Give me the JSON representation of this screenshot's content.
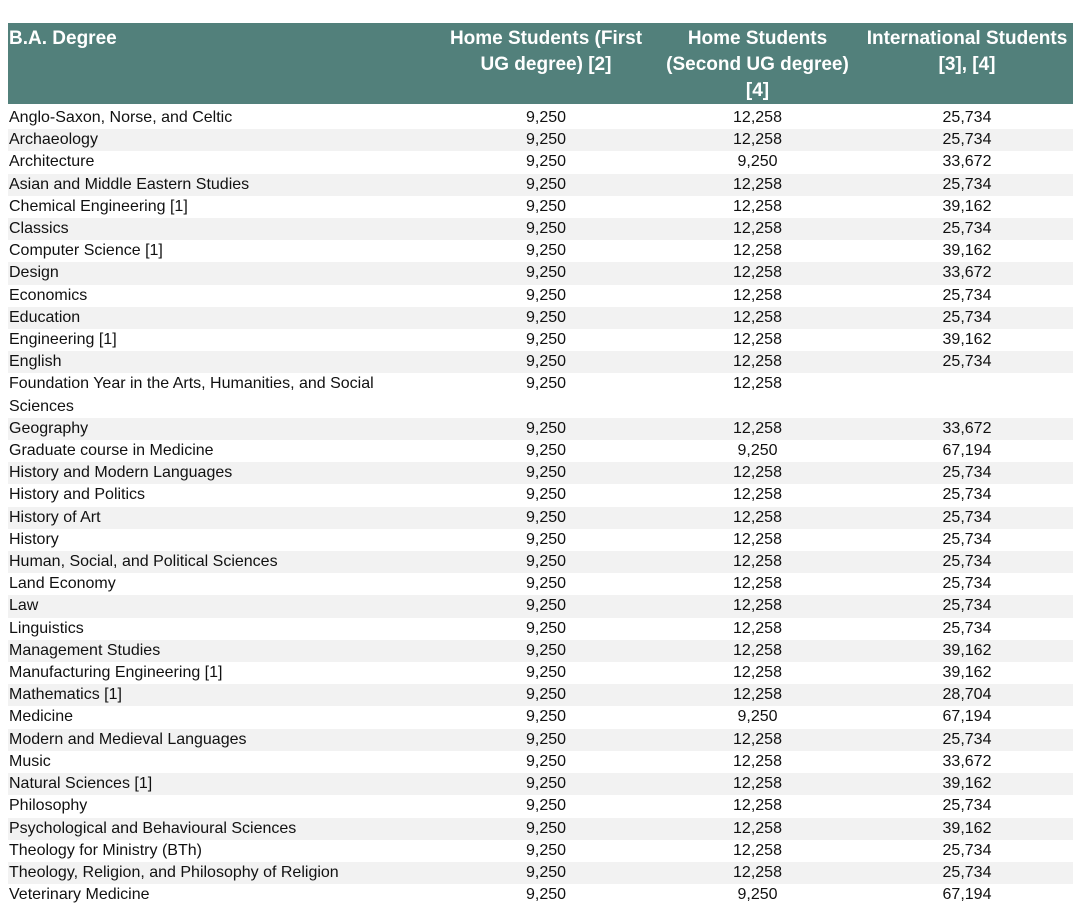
{
  "headers": {
    "degree": "B.A. Degree",
    "home_first": "Home Students (First UG degree) [2]",
    "home_second": "Home Students (Second UG degree) [4]",
    "international": "International Students [3], [4]"
  },
  "rows": [
    {
      "degree": "Anglo-Saxon, Norse, and Celtic",
      "home_first": "9,250",
      "home_second": "12,258",
      "international": "25,734"
    },
    {
      "degree": "Archaeology",
      "home_first": "9,250",
      "home_second": "12,258",
      "international": "25,734"
    },
    {
      "degree": "Architecture",
      "home_first": "9,250",
      "home_second": "9,250",
      "international": "33,672"
    },
    {
      "degree": "Asian and Middle Eastern Studies",
      "home_first": "9,250",
      "home_second": "12,258",
      "international": "25,734"
    },
    {
      "degree": "Chemical Engineering [1]",
      "home_first": "9,250",
      "home_second": "12,258",
      "international": "39,162"
    },
    {
      "degree": "Classics",
      "home_first": "9,250",
      "home_second": "12,258",
      "international": "25,734"
    },
    {
      "degree": "Computer Science [1]",
      "home_first": "9,250",
      "home_second": "12,258",
      "international": "39,162"
    },
    {
      "degree": "Design",
      "home_first": "9,250",
      "home_second": "12,258",
      "international": "33,672"
    },
    {
      "degree": "Economics",
      "home_first": "9,250",
      "home_second": "12,258",
      "international": "25,734"
    },
    {
      "degree": "Education",
      "home_first": "9,250",
      "home_second": "12,258",
      "international": "25,734"
    },
    {
      "degree": "Engineering [1]",
      "home_first": "9,250",
      "home_second": "12,258",
      "international": "39,162"
    },
    {
      "degree": "English",
      "home_first": "9,250",
      "home_second": "12,258",
      "international": "25,734"
    },
    {
      "degree": "Foundation Year in the Arts, Humanities, and Social Sciences",
      "home_first": "9,250",
      "home_second": "12,258",
      "international": ""
    },
    {
      "degree": "Geography",
      "home_first": "9,250",
      "home_second": "12,258",
      "international": "33,672"
    },
    {
      "degree": "Graduate course in Medicine",
      "home_first": "9,250",
      "home_second": "9,250",
      "international": "67,194"
    },
    {
      "degree": "History and Modern Languages",
      "home_first": "9,250",
      "home_second": "12,258",
      "international": "25,734"
    },
    {
      "degree": "History and Politics",
      "home_first": "9,250",
      "home_second": "12,258",
      "international": "25,734"
    },
    {
      "degree": "History of Art",
      "home_first": "9,250",
      "home_second": "12,258",
      "international": "25,734"
    },
    {
      "degree": "History",
      "home_first": "9,250",
      "home_second": "12,258",
      "international": "25,734"
    },
    {
      "degree": "Human, Social, and Political Sciences",
      "home_first": "9,250",
      "home_second": "12,258",
      "international": "25,734"
    },
    {
      "degree": "Land Economy",
      "home_first": "9,250",
      "home_second": "12,258",
      "international": "25,734"
    },
    {
      "degree": "Law",
      "home_first": "9,250",
      "home_second": "12,258",
      "international": "25,734"
    },
    {
      "degree": "Linguistics",
      "home_first": "9,250",
      "home_second": "12,258",
      "international": "25,734"
    },
    {
      "degree": "Management Studies",
      "home_first": "9,250",
      "home_second": "12,258",
      "international": "39,162"
    },
    {
      "degree": "Manufacturing Engineering [1]",
      "home_first": "9,250",
      "home_second": "12,258",
      "international": "39,162"
    },
    {
      "degree": "Mathematics [1]",
      "home_first": "9,250",
      "home_second": "12,258",
      "international": "28,704"
    },
    {
      "degree": "Medicine",
      "home_first": "9,250",
      "home_second": "9,250",
      "international": "67,194"
    },
    {
      "degree": "Modern and Medieval Languages",
      "home_first": "9,250",
      "home_second": "12,258",
      "international": "25,734"
    },
    {
      "degree": "Music",
      "home_first": "9,250",
      "home_second": "12,258",
      "international": "33,672"
    },
    {
      "degree": "Natural Sciences [1]",
      "home_first": "9,250",
      "home_second": "12,258",
      "international": "39,162"
    },
    {
      "degree": "Philosophy",
      "home_first": "9,250",
      "home_second": "12,258",
      "international": "25,734"
    },
    {
      "degree": "Psychological and Behavioural Sciences",
      "home_first": "9,250",
      "home_second": "12,258",
      "international": "39,162"
    },
    {
      "degree": "Theology for Ministry (BTh)",
      "home_first": "9,250",
      "home_second": "12,258",
      "international": "25,734"
    },
    {
      "degree": "Theology, Religion, and Philosophy of Religion",
      "home_first": "9,250",
      "home_second": "12,258",
      "international": "25,734"
    },
    {
      "degree": "Veterinary Medicine",
      "home_first": "9,250",
      "home_second": "9,250",
      "international": "67,194"
    }
  ]
}
